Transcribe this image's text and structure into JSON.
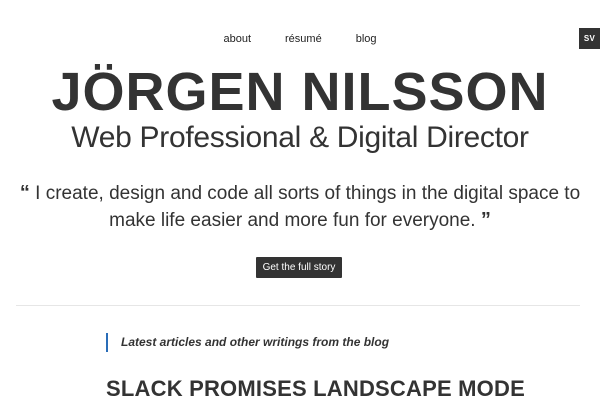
{
  "nav": {
    "items": [
      {
        "label": "about"
      },
      {
        "label": "résumé"
      },
      {
        "label": "blog"
      }
    ]
  },
  "lang_badge": "SV",
  "header": {
    "title": "JÖRGEN NILSSON",
    "subtitle": "Web Professional & Digital Director"
  },
  "quote": {
    "open_mark": "“",
    "line1": "I create, design and code all sorts of things in the digital space to",
    "line2": "make life easier and more fun for everyone.",
    "close_mark": "”"
  },
  "cta": {
    "label": "Get the full story"
  },
  "blog": {
    "intro": "Latest articles and other writings from the blog",
    "accent_color": "#2a6db8",
    "latest_post_title": "SLACK PROMISES LANDSCAPE MODE"
  }
}
